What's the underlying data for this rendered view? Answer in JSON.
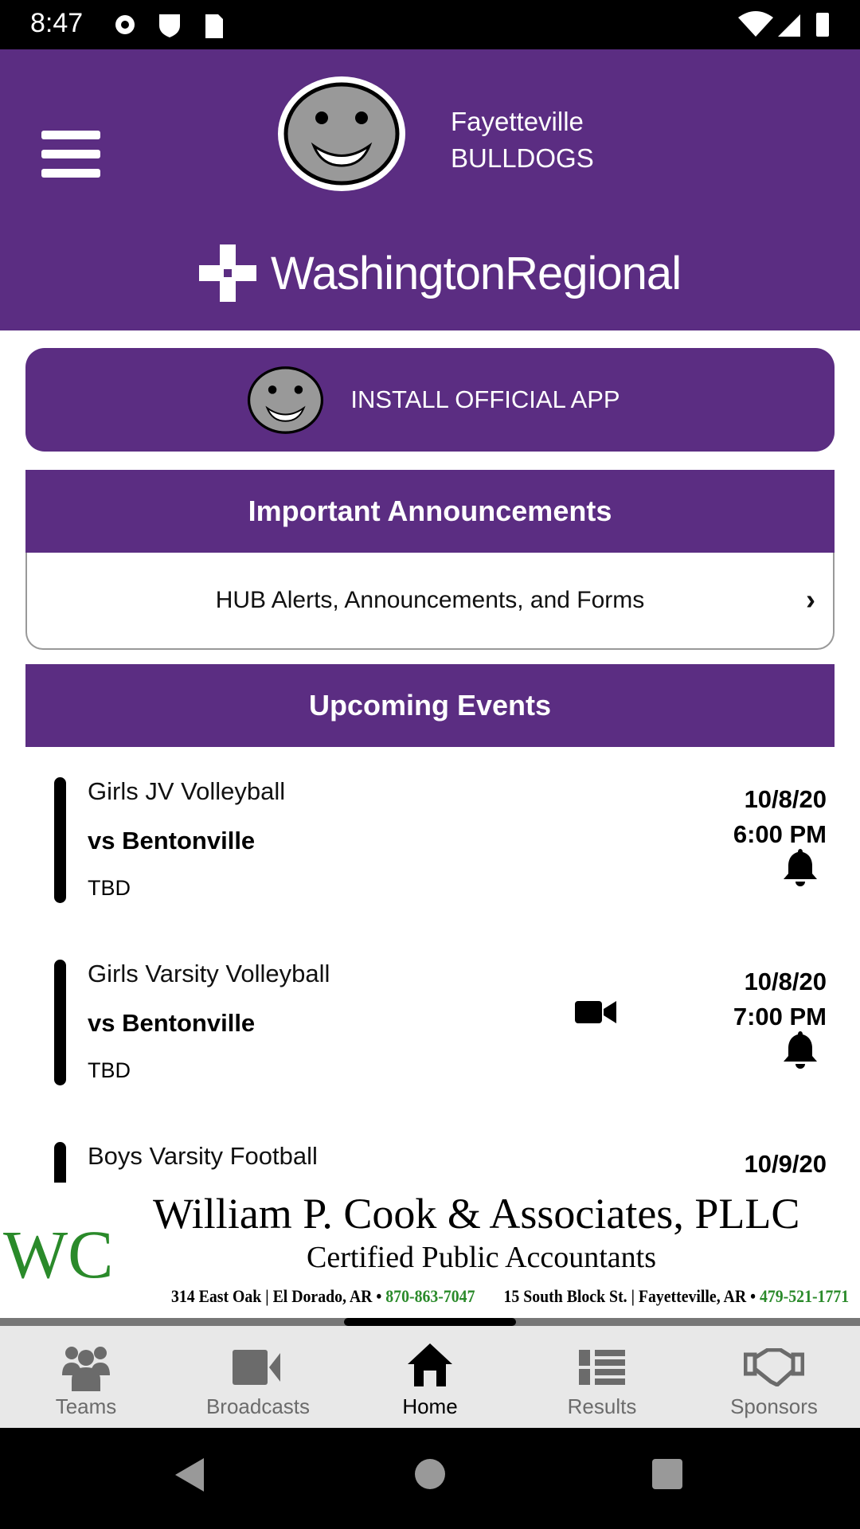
{
  "status_bar": {
    "time": "8:47"
  },
  "header": {
    "school_line1": "Fayetteville",
    "school_line2": "BULLDOGS",
    "sponsor_banner": "WashingtonRegional"
  },
  "install": {
    "label": "INSTALL OFFICIAL APP"
  },
  "announcements": {
    "title": "Important Announcements",
    "item": "HUB Alerts, Announcements, and Forms"
  },
  "events": {
    "title": "Upcoming Events",
    "items": [
      {
        "title": "Girls JV Volleyball",
        "opponent": "vs Bentonville",
        "location": "TBD",
        "date": "10/8/20",
        "time": "6:00 PM",
        "broadcast": false
      },
      {
        "title": "Girls Varsity Volleyball",
        "opponent": "vs Bentonville",
        "location": "TBD",
        "date": "10/8/20",
        "time": "7:00 PM",
        "broadcast": true
      },
      {
        "title": "Boys Varsity Football",
        "date": "10/9/20"
      }
    ]
  },
  "ad": {
    "name": "William P. Cook & Associates, PLLC",
    "subtitle": "Certified Public Accountants",
    "addr1": "314 East Oak | El Dorado, AR • ",
    "phone1": "870-863-7047",
    "addr2": "15 South Block St. | Fayetteville, AR • ",
    "phone2": "479-521-1771",
    "logo_text": "WC"
  },
  "tabs": [
    {
      "label": "Teams"
    },
    {
      "label": "Broadcasts"
    },
    {
      "label": "Home",
      "active": true
    },
    {
      "label": "Results"
    },
    {
      "label": "Sponsors"
    }
  ],
  "colors": {
    "brand": "#5b2d82",
    "ad_green": "#2a8a2a"
  }
}
